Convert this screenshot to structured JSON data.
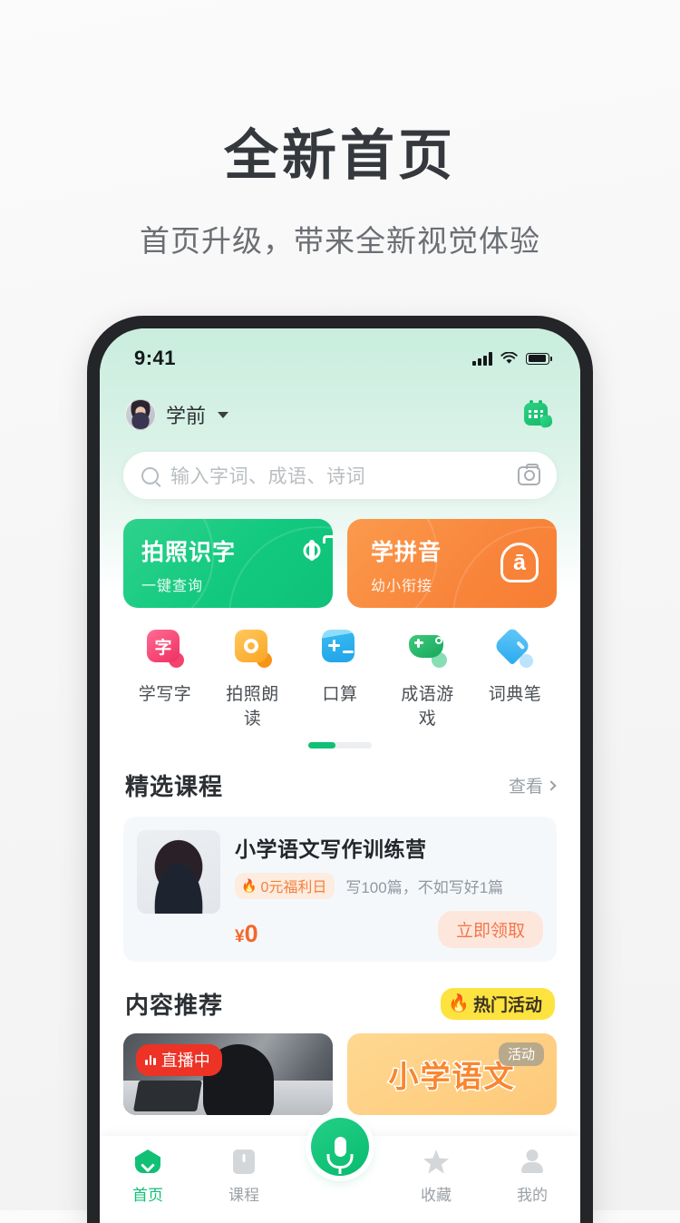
{
  "promo": {
    "title": "全新首页",
    "subtitle": "首页升级，带来全新视觉体验"
  },
  "status_bar": {
    "time": "9:41",
    "signal_icon": "cellular-signal-icon",
    "wifi_icon": "wifi-icon",
    "battery_icon": "battery-icon"
  },
  "top_bar": {
    "avatar": "user-avatar",
    "grade_label": "学前",
    "dropdown_icon": "chevron-down-icon",
    "calendar_icon": "calendar-check-icon"
  },
  "search": {
    "placeholder": "输入字词、成语、诗词",
    "search_icon": "search-icon",
    "camera_icon": "camera-icon"
  },
  "banners": [
    {
      "title": "拍照识字",
      "subtitle": "一键查询",
      "icon": "camera-icon",
      "color": "#12c97f"
    },
    {
      "title": "学拼音",
      "subtitle": "幼小衔接",
      "icon": "pinyin-a-icon",
      "glyph": "ā",
      "color": "#f8853b"
    }
  ],
  "quick_entries": {
    "items": [
      {
        "label": "学写字",
        "icon": "character-write-icon",
        "glyph": "字",
        "color": "#f2456d"
      },
      {
        "label": "拍照朗读",
        "icon": "photo-read-icon",
        "color": "#fbb03b"
      },
      {
        "label": "口算",
        "icon": "mental-math-icon",
        "color": "#3ec2f0"
      },
      {
        "label": "成语游戏",
        "icon": "gamepad-icon",
        "color": "#27bd70"
      },
      {
        "label": "词典笔",
        "icon": "dictionary-pen-icon",
        "color": "#3eb4f2"
      }
    ],
    "pager": {
      "pages": 2,
      "active": 1
    }
  },
  "featured_courses": {
    "title": "精选课程",
    "more_label": "查看",
    "more_icon": "chevron-right-icon",
    "card": {
      "thumbnail": "teacher-portrait",
      "title": "小学语文写作训练营",
      "badge": "0元福利日",
      "badge_icon": "flame-icon",
      "description": "写100篇，不如写好1篇",
      "price_symbol": "¥",
      "price": "0",
      "button_label": "立即领取"
    }
  },
  "content_recommend": {
    "title": "内容推荐",
    "hot_badge": "热门活动",
    "hot_badge_icon": "flame-icon",
    "cards": [
      {
        "type": "live",
        "badge": "直播中",
        "badge_icon": "live-wave-icon"
      },
      {
        "type": "activity",
        "text": "小学语文",
        "tag": "活动"
      }
    ]
  },
  "tabbar": {
    "items": [
      {
        "label": "首页",
        "icon": "home-icon",
        "active": true
      },
      {
        "label": "课程",
        "icon": "book-icon",
        "active": false
      },
      {
        "label": "收藏",
        "icon": "star-icon",
        "active": false
      },
      {
        "label": "我的",
        "icon": "person-icon",
        "active": false
      }
    ],
    "center_button": {
      "icon": "microphone-icon"
    }
  },
  "colors": {
    "brand_green": "#11c074",
    "accent_orange": "#f8853b",
    "hot_yellow": "#fde33f",
    "live_red": "#ed3226"
  }
}
